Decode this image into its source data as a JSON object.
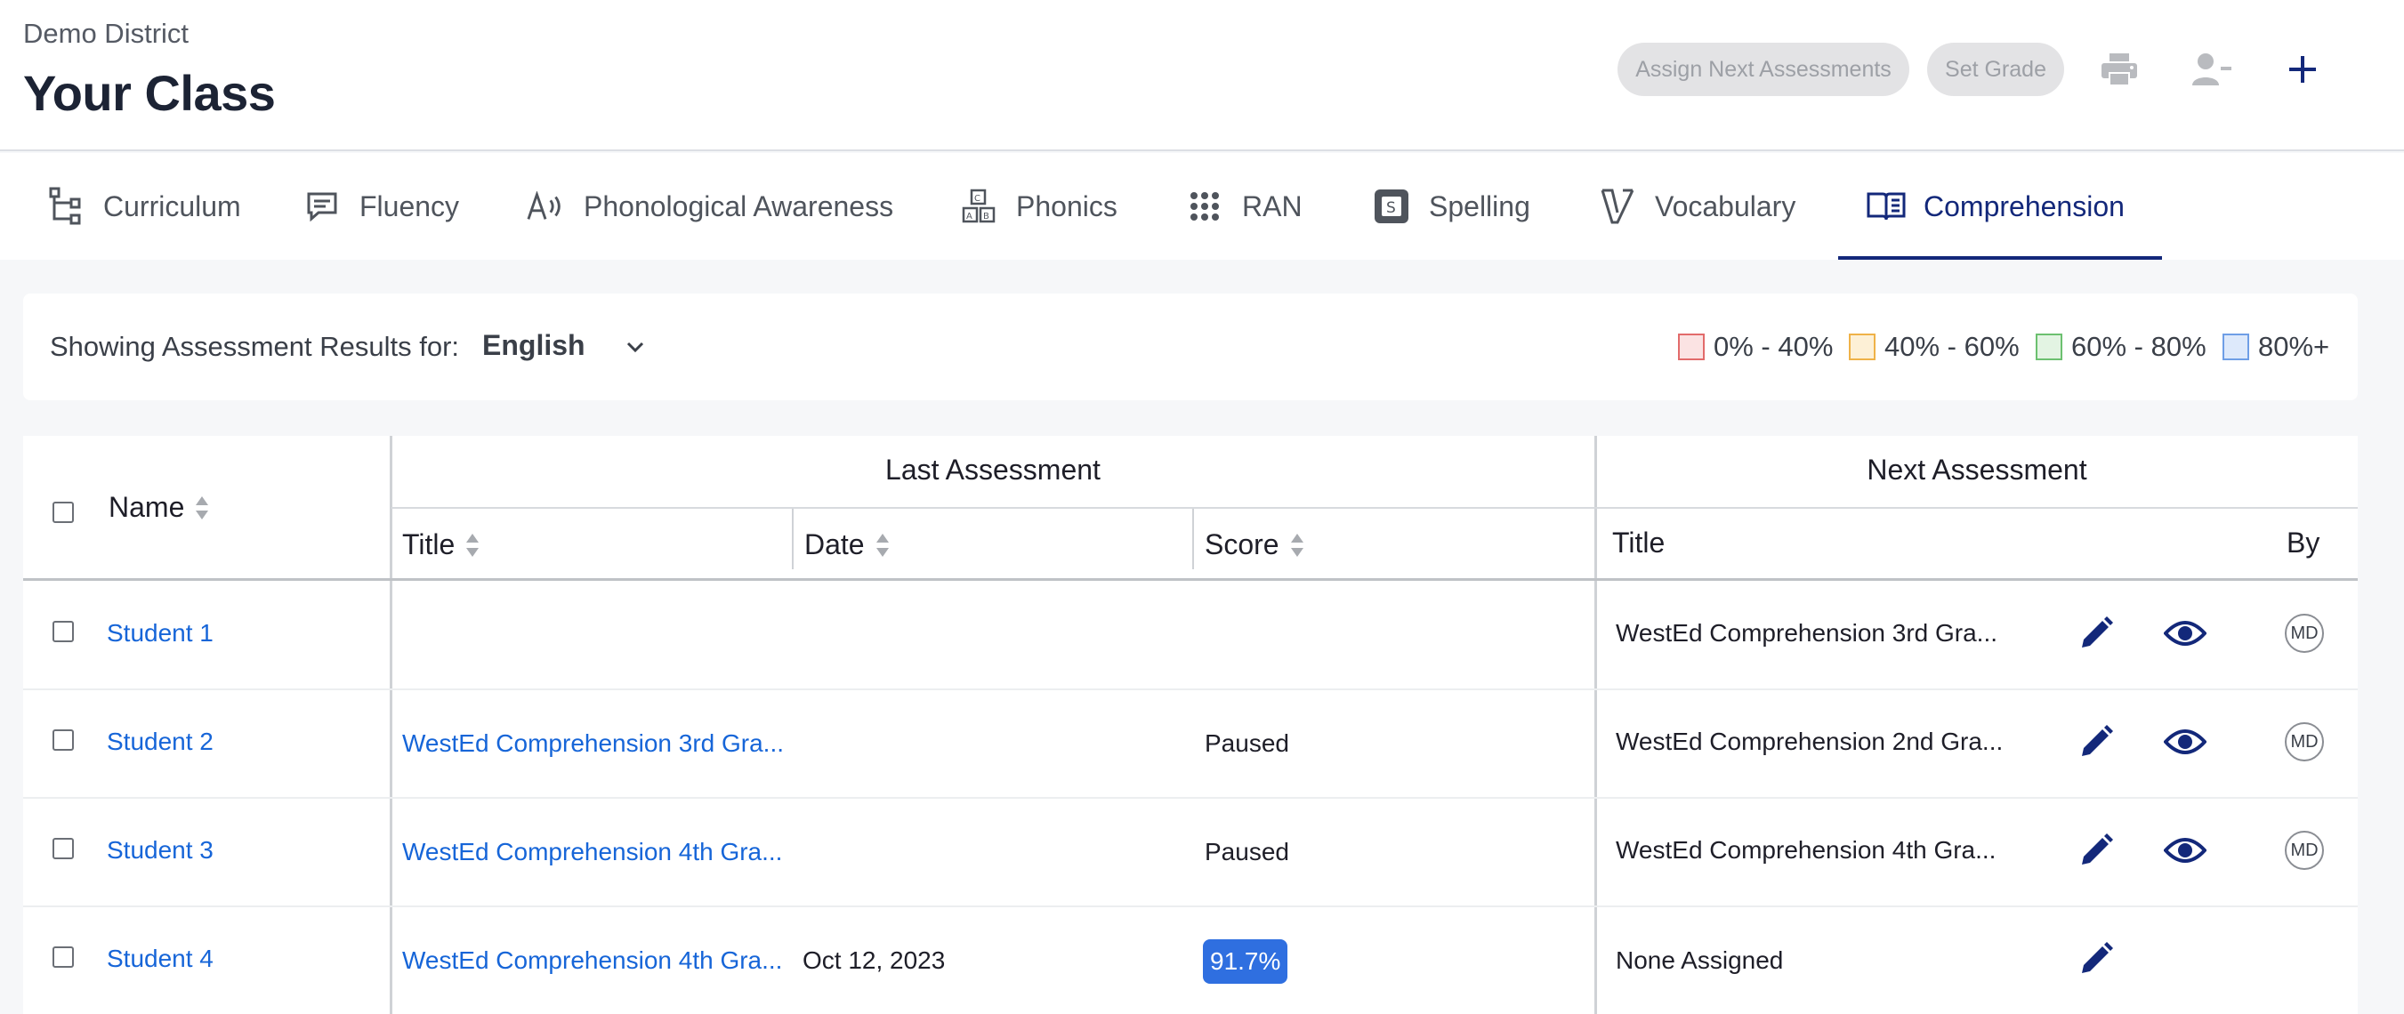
{
  "header": {
    "district": "Demo District",
    "title": "Your Class",
    "assign_button": "Assign Next Assessments",
    "set_grade_button": "Set Grade"
  },
  "tabs": [
    {
      "label": "Curriculum",
      "icon": "curriculum-tree-icon"
    },
    {
      "label": "Fluency",
      "icon": "chat-icon"
    },
    {
      "label": "Phonological Awareness",
      "icon": "sound-a-icon"
    },
    {
      "label": "Phonics",
      "icon": "abc-blocks-icon"
    },
    {
      "label": "RAN",
      "icon": "dot-grid-icon"
    },
    {
      "label": "Spelling",
      "icon": "s-box-icon"
    },
    {
      "label": "Vocabulary",
      "icon": "v-book-icon"
    },
    {
      "label": "Comprehension",
      "icon": "open-book-icon",
      "active": true
    }
  ],
  "filter": {
    "label": "Showing Assessment Results for:",
    "language": "English",
    "legend": [
      {
        "label": "0% - 40%",
        "fill": "#fbe3e3",
        "border": "#e26b6b"
      },
      {
        "label": "40% - 60%",
        "fill": "#fdf0d6",
        "border": "#efb248"
      },
      {
        "label": "60% - 80%",
        "fill": "#e3f4e3",
        "border": "#6cc070"
      },
      {
        "label": "80%+",
        "fill": "#dde9fb",
        "border": "#6e9ee6"
      }
    ]
  },
  "table": {
    "group_last": "Last Assessment",
    "group_next": "Next Assessment",
    "col_name": "Name",
    "col_title": "Title",
    "col_date": "Date",
    "col_score": "Score",
    "col_next_title": "Title",
    "col_by": "By",
    "rows": [
      {
        "name": "Student 1",
        "last_title": "",
        "date": "",
        "score": "",
        "next_title": "WestEd Comprehension 3rd Gra...",
        "by": "MD"
      },
      {
        "name": "Student 2",
        "last_title": "WestEd Comprehension 3rd Gra...",
        "date": "",
        "score": "Paused",
        "next_title": "WestEd Comprehension 2nd Gra...",
        "by": "MD"
      },
      {
        "name": "Student 3",
        "last_title": "WestEd Comprehension 4th Gra...",
        "date": "",
        "score": "Paused",
        "next_title": "WestEd Comprehension 4th Gra...",
        "by": "MD"
      },
      {
        "name": "Student 4",
        "last_title": "WestEd Comprehension 4th Gra...",
        "date": "Oct 12, 2023",
        "score": "91.7%",
        "next_title": "None Assigned",
        "by": ""
      }
    ]
  },
  "colors": {
    "accent": "#13287a",
    "link": "#1665d8",
    "score_badge": "#2f6fe0"
  }
}
